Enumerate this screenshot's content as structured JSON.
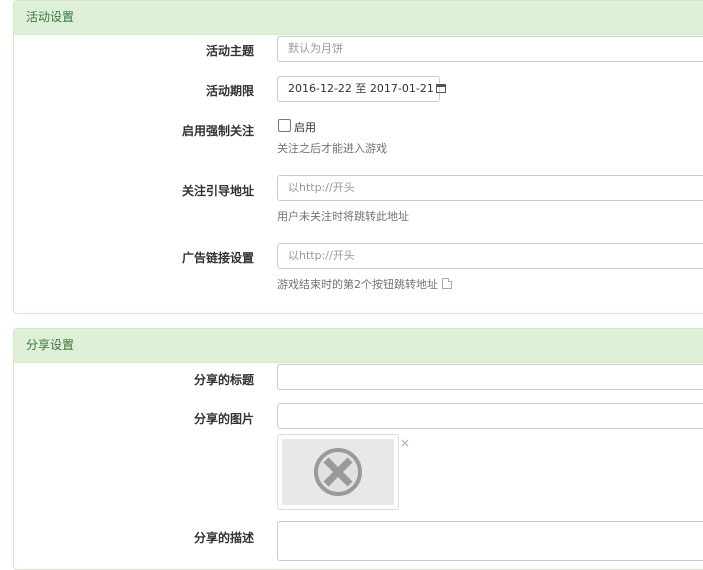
{
  "activity_panel": {
    "heading": "活动设置",
    "theme": {
      "label": "活动主题",
      "placeholder": "默认为月饼"
    },
    "period": {
      "label": "活动期限",
      "value": "2016-12-22 至 2017-01-21"
    },
    "force_follow": {
      "label": "启用强制关注",
      "checkbox_label": "启用",
      "checked": false,
      "help": "关注之后才能进入游戏"
    },
    "follow_url": {
      "label": "关注引导地址",
      "placeholder": "以http://开头",
      "help": "用户未关注时将跳转此地址"
    },
    "ad_link": {
      "label": "广告链接设置",
      "placeholder": "以http://开头",
      "help": "游戏结束时的第2个按钮跳转地址"
    }
  },
  "share_panel": {
    "heading": "分享设置",
    "share_title": {
      "label": "分享的标题",
      "value": ""
    },
    "share_image": {
      "label": "分享的图片",
      "value": "",
      "remove_symbol": "×"
    },
    "share_desc": {
      "label": "分享的描述",
      "value": ""
    }
  },
  "icons": [
    "calendar-icon",
    "external-link-icon",
    "image-placeholder-icon",
    "remove-image-icon"
  ],
  "colors": {
    "panel_heading_bg": "#dff0d8",
    "panel_heading_text": "#3c763d",
    "panel_border": "#d6e9c6"
  }
}
